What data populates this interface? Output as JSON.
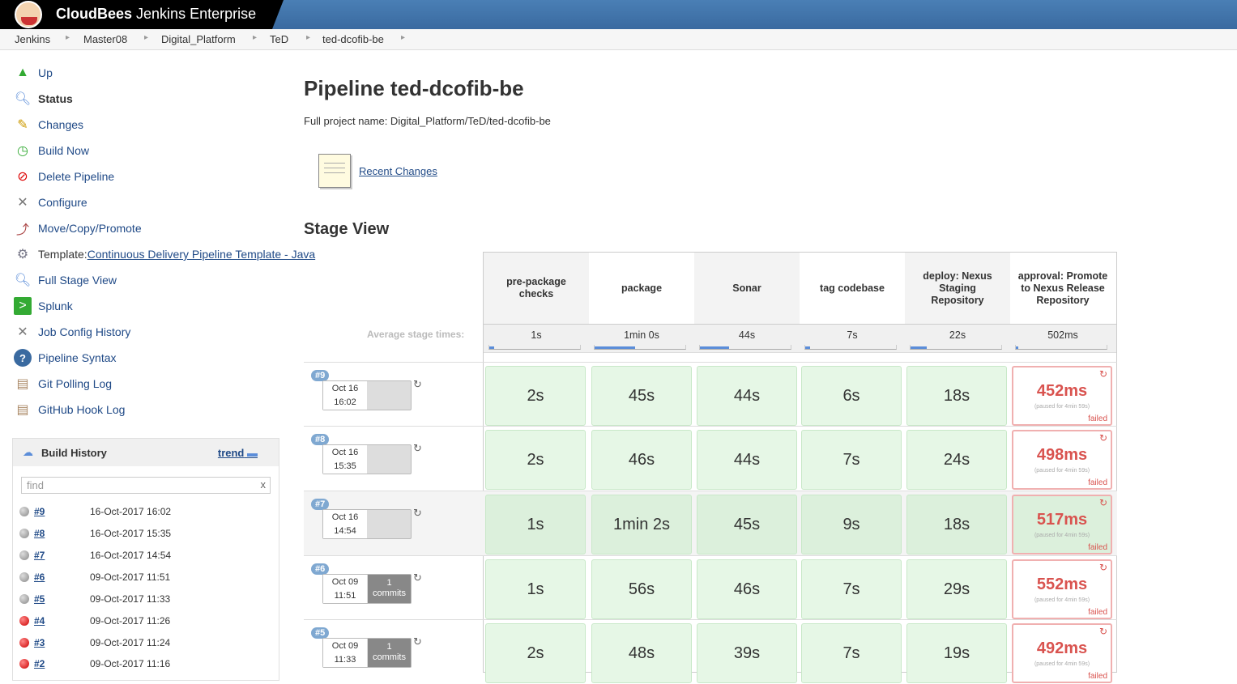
{
  "header": {
    "brand_bold": "CloudBees",
    "brand_rest": " Jenkins Enterprise"
  },
  "breadcrumbs": [
    "Jenkins",
    "Master08",
    "Digital_Platform",
    "TeD",
    "ted-dcofib-be"
  ],
  "sidebar": {
    "items": [
      {
        "label": "Up",
        "icon": "up-arrow-icon"
      },
      {
        "label": "Status",
        "icon": "magnifier-icon"
      },
      {
        "label": "Changes",
        "icon": "notepad-icon"
      },
      {
        "label": "Build Now",
        "icon": "clock-play-icon"
      },
      {
        "label": "Delete Pipeline",
        "icon": "no-entry-icon"
      },
      {
        "label": "Configure",
        "icon": "tools-icon"
      },
      {
        "label": "Move/Copy/Promote",
        "icon": "joystick-icon"
      },
      {
        "label": "Template: ",
        "icon": "gear-icon",
        "link": "Continuous Delivery Pipeline Template - Java"
      },
      {
        "label": "Full Stage View",
        "icon": "magnifier-icon"
      },
      {
        "label": "Splunk",
        "icon": "splunk-icon"
      },
      {
        "label": "Job Config History",
        "icon": "tools-icon"
      },
      {
        "label": "Pipeline Syntax",
        "icon": "help-icon"
      },
      {
        "label": "Git Polling Log",
        "icon": "clipboard-icon"
      },
      {
        "label": "GitHub Hook Log",
        "icon": "clipboard-icon"
      }
    ]
  },
  "build_history": {
    "title": "Build History",
    "trend": "trend",
    "find_placeholder": "find",
    "clear": "x",
    "rows": [
      {
        "num": "#9",
        "date": "16-Oct-2017 16:02",
        "status": "grey"
      },
      {
        "num": "#8",
        "date": "16-Oct-2017 15:35",
        "status": "grey"
      },
      {
        "num": "#7",
        "date": "16-Oct-2017 14:54",
        "status": "grey"
      },
      {
        "num": "#6",
        "date": "09-Oct-2017 11:51",
        "status": "grey"
      },
      {
        "num": "#5",
        "date": "09-Oct-2017 11:33",
        "status": "grey"
      },
      {
        "num": "#4",
        "date": "09-Oct-2017 11:26",
        "status": "red"
      },
      {
        "num": "#3",
        "date": "09-Oct-2017 11:24",
        "status": "red"
      },
      {
        "num": "#2",
        "date": "09-Oct-2017 11:16",
        "status": "red"
      }
    ]
  },
  "main": {
    "title": "Pipeline ted-dcofib-be",
    "full_name": "Full project name: Digital_Platform/TeD/ted-dcofib-be",
    "recent_changes": "Recent Changes",
    "stage_view_title": "Stage View",
    "avg_label": "Average stage times:"
  },
  "stages": [
    {
      "name": "pre-package checks",
      "avg": "1s",
      "fill": 0.05
    },
    {
      "name": "package",
      "avg": "1min 0s",
      "fill": 0.45
    },
    {
      "name": "Sonar",
      "avg": "44s",
      "fill": 0.32
    },
    {
      "name": "tag codebase",
      "avg": "7s",
      "fill": 0.05
    },
    {
      "name": "deploy: Nexus Staging Repository",
      "avg": "22s",
      "fill": 0.18
    },
    {
      "name": "approval: Promote to Nexus Release Repository",
      "avg": "502ms",
      "fill": 0.01
    }
  ],
  "runs": [
    {
      "badge": "#9",
      "date": "Oct 16",
      "time": "16:02",
      "commits": "",
      "commits_label": "",
      "cells": [
        "2s",
        "45s",
        "44s",
        "6s",
        "18s"
      ],
      "last": "452ms"
    },
    {
      "badge": "#8",
      "date": "Oct 16",
      "time": "15:35",
      "commits": "",
      "commits_label": "",
      "cells": [
        "2s",
        "46s",
        "44s",
        "7s",
        "24s"
      ],
      "last": "498ms"
    },
    {
      "badge": "#7",
      "date": "Oct 16",
      "time": "14:54",
      "commits": "",
      "commits_label": "",
      "cells": [
        "1s",
        "1min 2s",
        "45s",
        "9s",
        "18s"
      ],
      "last": "517ms"
    },
    {
      "badge": "#6",
      "date": "Oct 09",
      "time": "11:51",
      "commits": "1",
      "commits_label": "commits",
      "cells": [
        "1s",
        "56s",
        "46s",
        "7s",
        "29s"
      ],
      "last": "552ms"
    },
    {
      "badge": "#5",
      "date": "Oct 09",
      "time": "11:33",
      "commits": "1",
      "commits_label": "commits",
      "cells": [
        "2s",
        "48s",
        "39s",
        "7s",
        "19s"
      ],
      "last": "492ms"
    }
  ],
  "fail_paused": "(paused for 4min 59s)",
  "fail_label": "failed"
}
